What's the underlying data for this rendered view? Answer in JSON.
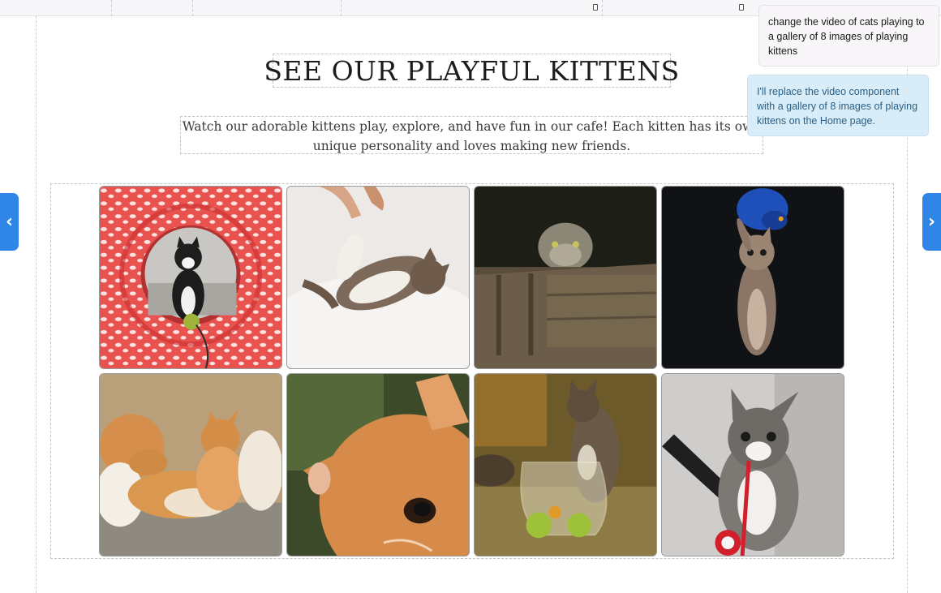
{
  "page": {
    "title": "SEE OUR PLAYFUL KITTENS",
    "description_line1": "Watch our adorable kittens play, explore, and have fun in our cafe! Each kitten has its own",
    "description_line2": "unique personality and loves making new friends."
  },
  "gallery": {
    "images": [
      {
        "subject": "black-and-white kitten inside red patterned play tunnel with toy ball"
      },
      {
        "subject": "tabby kitten on back on white fur rug reaching for hand"
      },
      {
        "subject": "manul cat sitting in wooden crate"
      },
      {
        "subject": "kitten standing up with blue feather toy on dark background"
      },
      {
        "subject": "group of orange and white kittens sleeping together"
      },
      {
        "subject": "close-up of orange kitten face"
      },
      {
        "subject": "tabby kitten playing with glass fishbowl and balls"
      },
      {
        "subject": "tabby and white kitten biting red cat toy"
      }
    ]
  },
  "navigation": {
    "prev_icon": "chevron-left-icon",
    "next_icon": "chevron-right-icon",
    "prev_glyph": "‹",
    "next_glyph": "›"
  },
  "chat": {
    "user_message": "change the video of cats playing to a gallery of 8 images of playing kittens",
    "assistant_message": "I'll replace the video component with a gallery of 8 images of playing kittens on the Home page."
  },
  "colors": {
    "accent": "#2f86e6",
    "assistant_bubble": "#d8edf7",
    "assistant_text": "#2a5f86"
  }
}
